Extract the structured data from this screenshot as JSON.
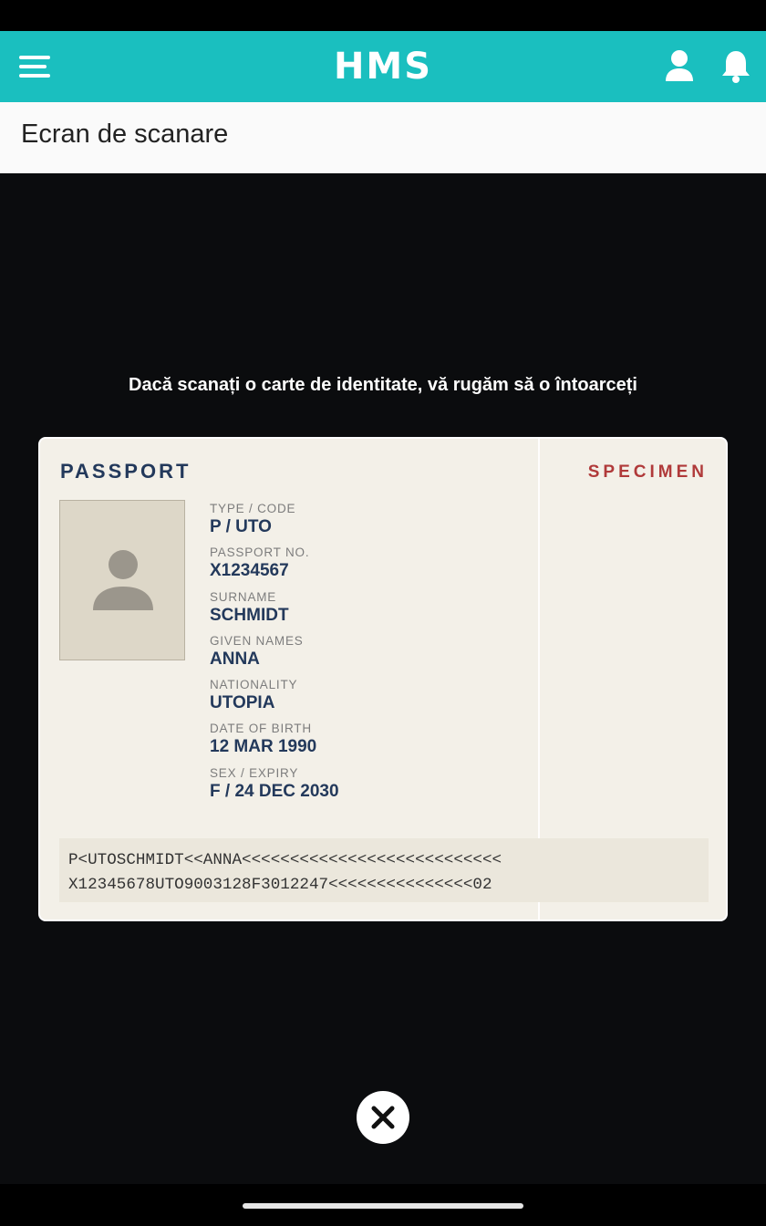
{
  "header": {
    "logo_text": "HMS",
    "background": "#1abfbf",
    "icons": [
      "menu-icon",
      "user-icon",
      "bell-icon"
    ]
  },
  "page": {
    "title": "Ecran de scanare"
  },
  "scanner": {
    "instruction": "Dacă scanați o carte de identitate, vă rugăm să o întoarceți"
  },
  "document": {
    "type_label": "PASSPORT",
    "specimen_label": "SPECIMEN",
    "fields": [
      {
        "label": "TYPE / CODE",
        "value": "P / UTO"
      },
      {
        "label": "PASSPORT NO.",
        "value": "X1234567"
      },
      {
        "label": "SURNAME",
        "value": "SCHMIDT"
      },
      {
        "label": "GIVEN NAMES",
        "value": "ANNA"
      },
      {
        "label": "NATIONALITY",
        "value": "UTOPIA"
      },
      {
        "label": "DATE OF BIRTH",
        "value": "12 MAR 1990"
      },
      {
        "label": "SEX / EXPIRY",
        "value": "F / 24 DEC 2030"
      }
    ],
    "mrz_lines": [
      "P<UTOSCHMIDT<<ANNA<<<<<<<<<<<<<<<<<<<<<<<<<<<",
      "X12345678UTO9003128F3012247<<<<<<<<<<<<<<<02"
    ]
  },
  "controls": {
    "close_icon": "close-icon"
  }
}
